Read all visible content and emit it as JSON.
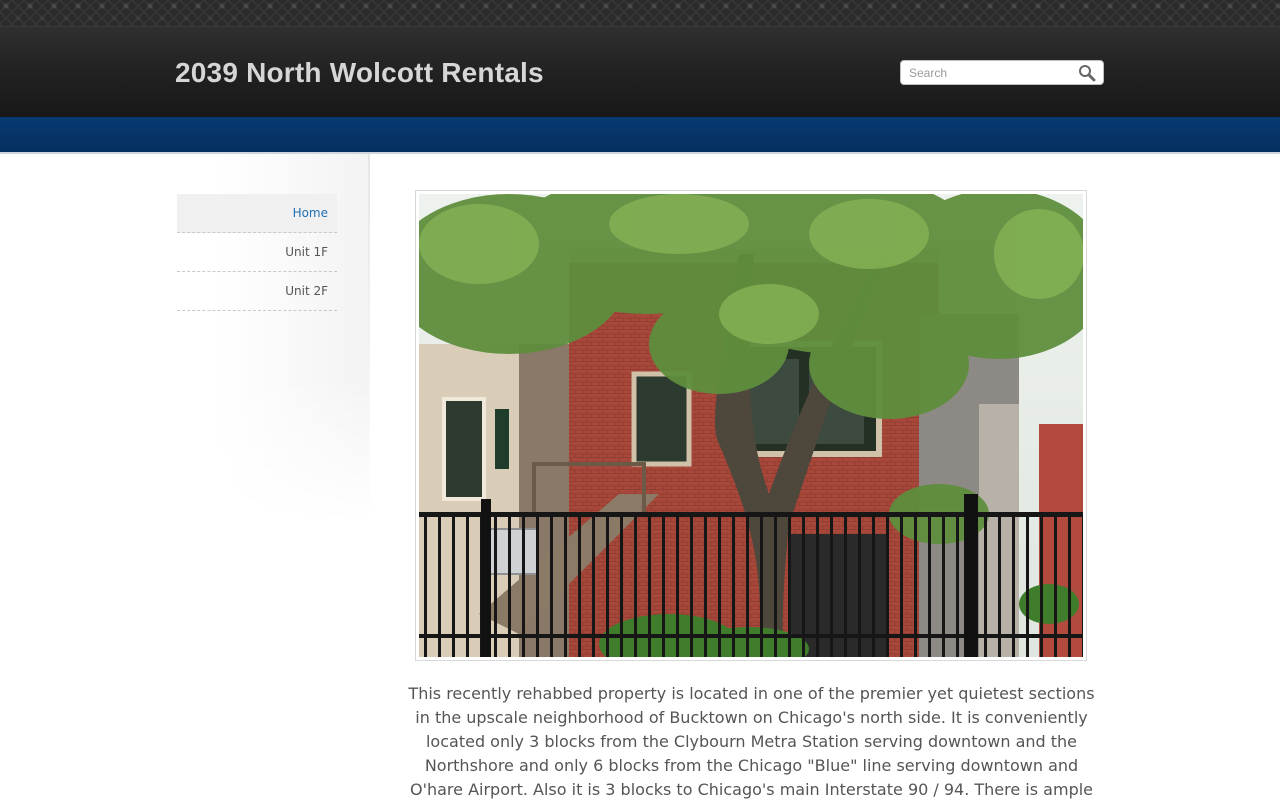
{
  "site": {
    "title": "2039 North Wolcott Rentals"
  },
  "search": {
    "placeholder": "Search",
    "value": "",
    "icon": "magnifier-icon"
  },
  "nav": {
    "items": [
      {
        "label": "Home",
        "active": true
      },
      {
        "label": "Unit 1F",
        "active": false
      },
      {
        "label": "Unit 2F",
        "active": false
      }
    ]
  },
  "main": {
    "photo": {
      "subject": "red brick two-flat building behind a tree and black iron fence"
    },
    "intro": "This recently rehabbed property is located in one of the premier yet quietest sections in the upscale neighborhood of Bucktown on Chicago's north side.  It is conveniently located  only 3 blocks from the Clybourn Metra Station serving downtown and the Northshore and only 6 blocks from the Chicago \"Blue\" line serving downtown and O'hare Airport.  Also it is 3 blocks to Chicago's main Interstate 90 / 94.  There is ample street"
  },
  "colors": {
    "header_bg": "#222222",
    "nav_band": "#063569",
    "title_text": "#d6d6d6",
    "nav_active": "#1f6fb2",
    "body_text": "#555555"
  }
}
